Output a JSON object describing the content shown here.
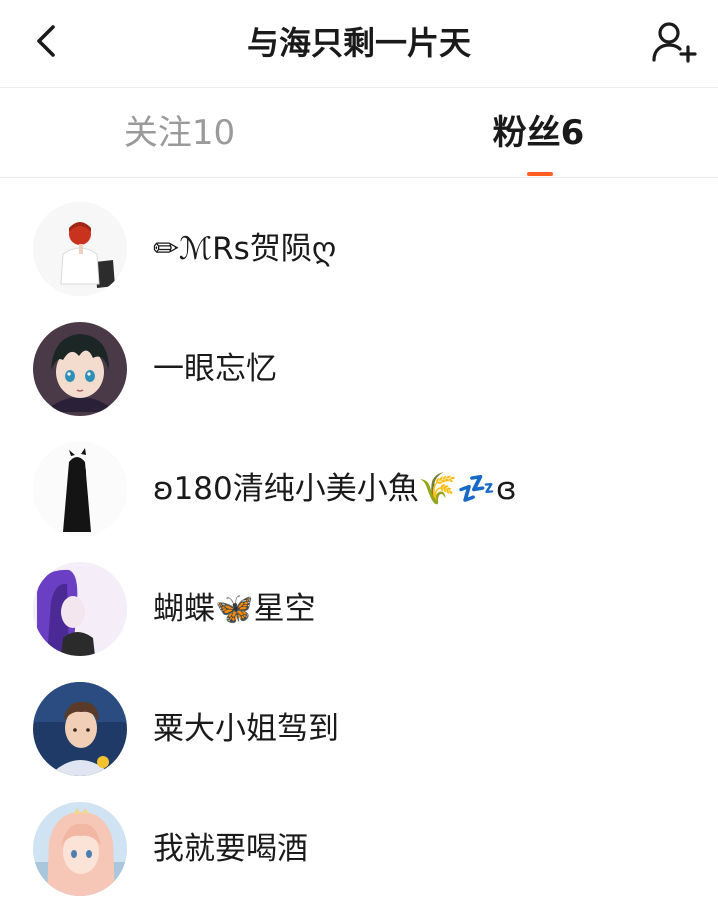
{
  "header": {
    "title": "与海只剩一片天"
  },
  "tabs": {
    "following_label": "关注10",
    "fans_label": "粉丝6"
  },
  "fans": [
    {
      "name": "✏ℳRs贺陨ღ"
    },
    {
      "name": "一眼忘忆"
    },
    {
      "name": "ʚ180清纯小美小魚🌾💤ɞ"
    },
    {
      "name": "蝴蝶🦋星空"
    },
    {
      "name": "粟大小姐驾到"
    },
    {
      "name": "我就要喝酒"
    }
  ],
  "colors": {
    "accent": "#fe5e1f",
    "text_primary": "#1a1a1a",
    "text_secondary": "#9a9a9a",
    "divider": "#ececec"
  },
  "icons": {
    "back": "chevron-left-icon",
    "add_user": "add-user-icon"
  }
}
